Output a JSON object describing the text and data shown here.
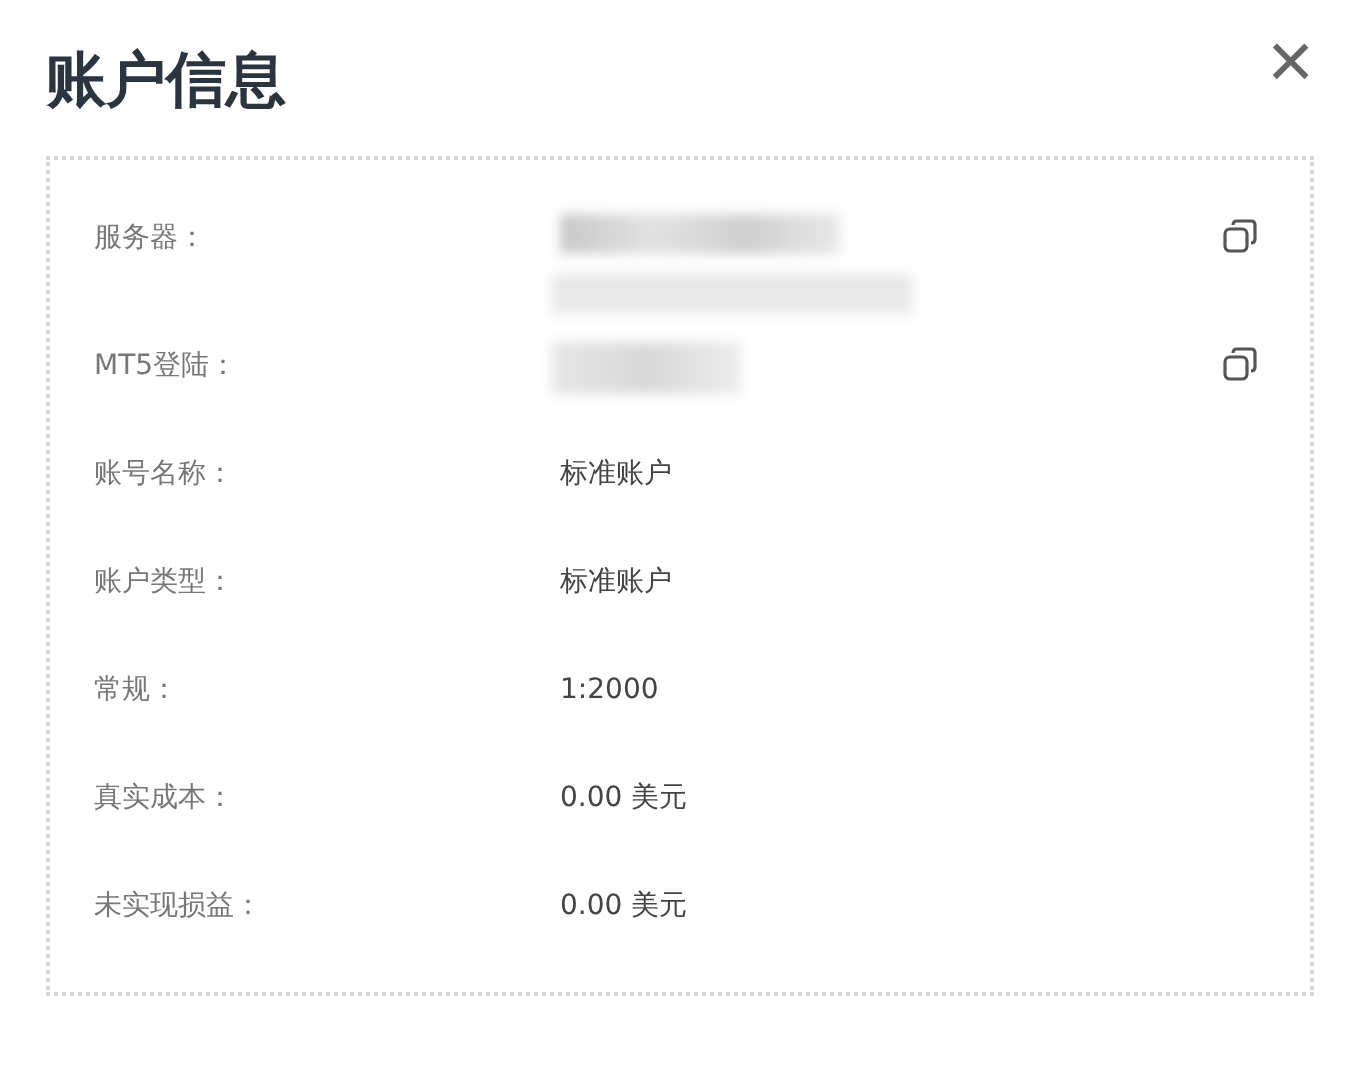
{
  "dialog": {
    "title": "账户信息",
    "close_glyph": "×"
  },
  "rows": [
    {
      "label": "服务器：",
      "kind": "blurred_two_line",
      "copyable": true
    },
    {
      "label": "MT5登陆：",
      "kind": "blurred_one_line",
      "copyable": true
    },
    {
      "label": "账号名称：",
      "kind": "text",
      "value": "标准账户",
      "copyable": false
    },
    {
      "label": "账户类型：",
      "kind": "text",
      "value": "标准账户",
      "copyable": false
    },
    {
      "label": "常规：",
      "kind": "text",
      "value": "1:2000",
      "copyable": false
    },
    {
      "label": "真实成本：",
      "kind": "text",
      "value": "0.00 美元",
      "copyable": false
    },
    {
      "label": "未实现损益：",
      "kind": "text",
      "value": "0.00 美元",
      "copyable": false
    }
  ]
}
